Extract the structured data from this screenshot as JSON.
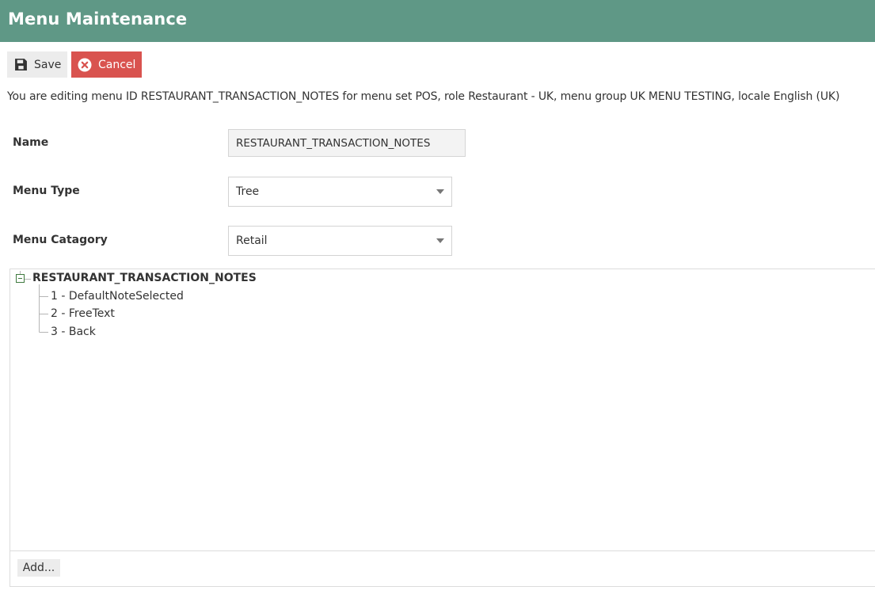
{
  "header": {
    "title": "Menu Maintenance"
  },
  "toolbar": {
    "save_label": "Save",
    "cancel_label": "Cancel"
  },
  "info_text": "You are editing menu ID RESTAURANT_TRANSACTION_NOTES for menu set POS, role Restaurant - UK, menu group UK MENU TESTING, locale English (UK)",
  "form": {
    "name_label": "Name",
    "name_value": "RESTAURANT_TRANSACTION_NOTES",
    "menu_type_label": "Menu Type",
    "menu_type_value": "Tree",
    "menu_category_label": "Menu Catagory",
    "menu_category_value": "Retail"
  },
  "tree": {
    "root_label": "RESTAURANT_TRANSACTION_NOTES",
    "root_expanded": true,
    "nodes": [
      {
        "label": "1 - DefaultNoteSelected"
      },
      {
        "label": "2 - FreeText"
      },
      {
        "label": "3 - Back"
      }
    ],
    "add_label": "Add..."
  },
  "colors": {
    "header_bg": "#5f9886",
    "cancel_bg": "#d9534f",
    "save_bg": "#ececec"
  },
  "icons": {
    "save": "floppy-disk-icon",
    "cancel": "x-circle-icon",
    "collapse": "minus-box-icon",
    "dropdown": "caret-down-icon"
  }
}
